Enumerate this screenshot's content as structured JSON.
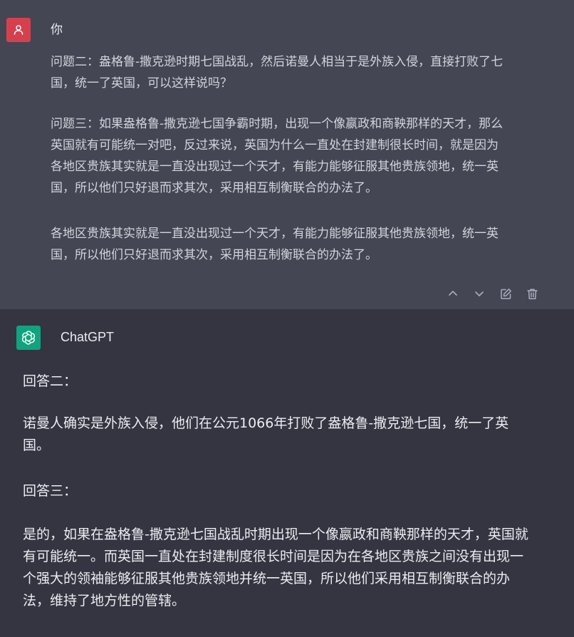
{
  "user_message": {
    "author": "你",
    "paragraphs": [
      "问题二：盎格鲁-撒克逊时期七国战乱，然后诺曼人相当于是外族入侵，直接打败了七\n国，统一了英国，可以这样说吗？",
      "问题三：如果盎格鲁-撒克逊七国争霸时期，出现一个像嬴政和商鞅那样的天才，那么\n英国就有可能统一对吧，反过来说，英国为什么一直处在封建制很长时间，就是因为\n各地区贵族其实就是一直没出现过一个天才，有能力能够征服其他贵族领地，统一英\n国，所以他们只好退而求其次，采用相互制衡联合的办法了。",
      "各地区贵族其实就是一直没出现过一个天才，有能力能够征服其他贵族领地，统一英\n国，所以他们只好退而求其次，采用相互制衡联合的办法了。"
    ]
  },
  "bot_message": {
    "author": "ChatGPT",
    "paragraphs": [
      "回答二：",
      "诺曼人确实是外族入侵，他们在公元1066年打败了盎格鲁-撒克逊七国，统一了英\n国。",
      "回答三：",
      "是的，如果在盎格鲁-撒克逊七国战乱时期出现一个像嬴政和商鞅那样的天才，英国就\n有可能统一。而英国一直处在封建制度很长时间是因为在各地区贵族之间没有出现一\n个强大的领袖能够征服其他贵族领地并统一英国，所以他们采用相互制衡联合的办\n法，维持了地方性的管辖。"
    ]
  },
  "icons": {
    "user_avatar": "user-icon",
    "bot_avatar": "openai-logo-icon",
    "actions": [
      "chevron-up-icon",
      "chevron-down-icon",
      "edit-icon",
      "trash-icon"
    ]
  },
  "colors": {
    "user_background": "#444654",
    "bot_background": "#343541",
    "user_avatar": "#d6404e",
    "bot_avatar": "#10a37f"
  }
}
